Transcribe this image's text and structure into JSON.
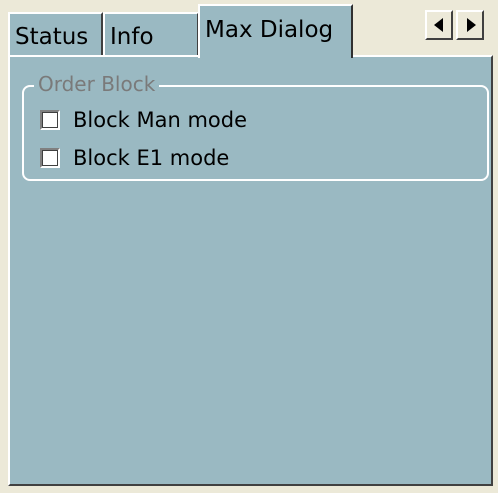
{
  "tabs": [
    {
      "label": "Status",
      "active": false
    },
    {
      "label": "Info",
      "active": false
    },
    {
      "label": "Max Dialog",
      "active": true
    }
  ],
  "scroll_buttons": {
    "left_icon": "triangle-left-icon",
    "right_icon": "triangle-right-icon"
  },
  "order_block": {
    "title": "Order Block",
    "options": [
      {
        "label": "Block Man mode",
        "checked": false
      },
      {
        "label": "Block E1 mode",
        "checked": false
      }
    ]
  },
  "colors": {
    "panel_background": "#9ab9c2",
    "chrome_background": "#ece9d8",
    "legend_text": "#7a7a7a"
  }
}
